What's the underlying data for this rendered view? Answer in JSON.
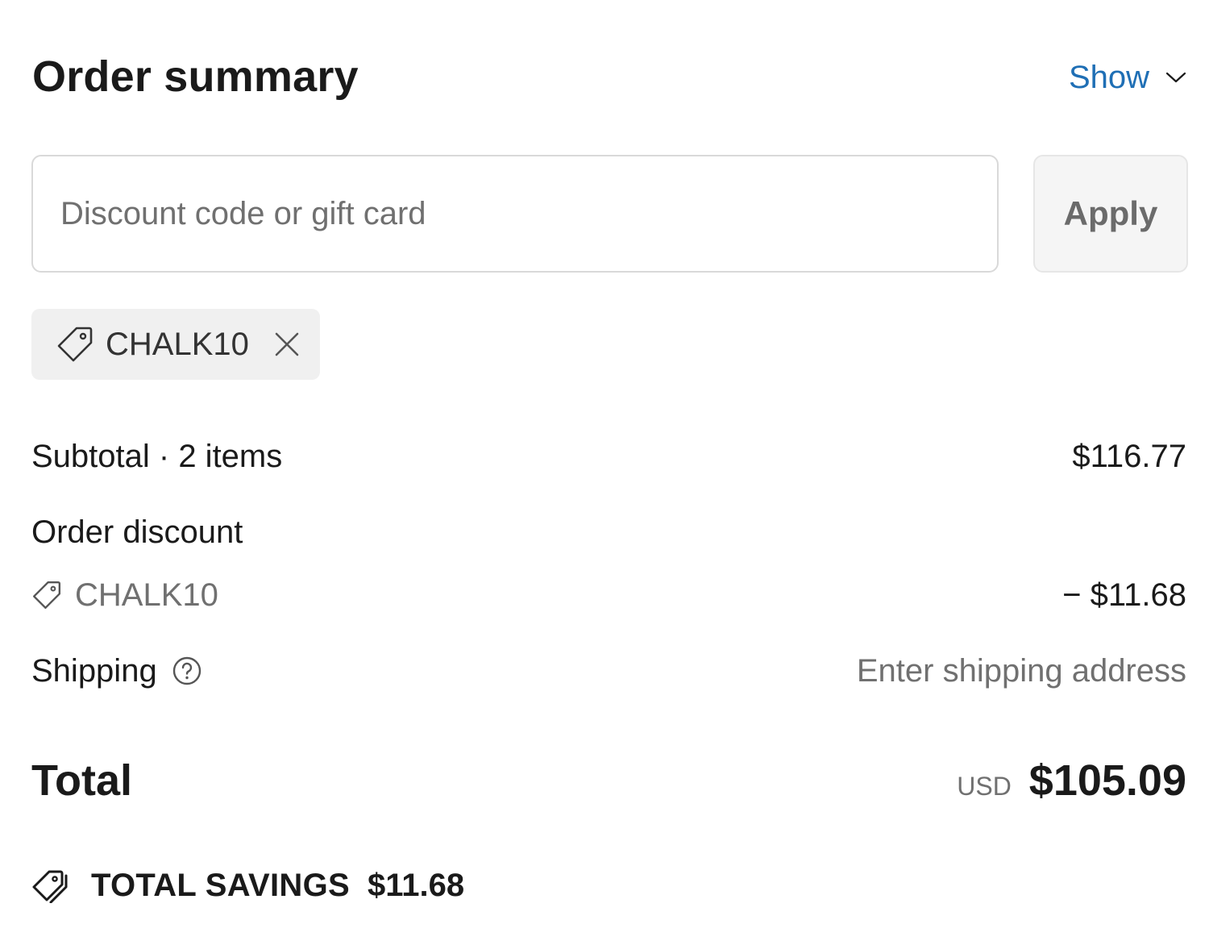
{
  "header": {
    "title": "Order summary",
    "toggle_label": "Show"
  },
  "discount_form": {
    "placeholder": "Discount code or gift card",
    "value": "",
    "apply_label": "Apply"
  },
  "applied_code": {
    "code": "CHALK10"
  },
  "lines": {
    "subtotal_label": "Subtotal · 2 items",
    "subtotal_value": "$116.77",
    "discount_label": "Order discount",
    "discount_code": "CHALK10",
    "discount_value": "− $11.68",
    "shipping_label": "Shipping",
    "shipping_value": "Enter shipping address"
  },
  "total": {
    "label": "Total",
    "currency": "USD",
    "value": "$105.09"
  },
  "savings": {
    "label": "TOTAL SAVINGS",
    "value": "$11.68"
  },
  "colors": {
    "link": "#1f6fb5",
    "muted_text": "#707070",
    "chip_bg": "#f0f0f0",
    "border": "#d9d9d9"
  },
  "icons": [
    "chevron-down-icon",
    "tag-icon",
    "close-icon",
    "help-circle-icon",
    "tags-icon"
  ]
}
